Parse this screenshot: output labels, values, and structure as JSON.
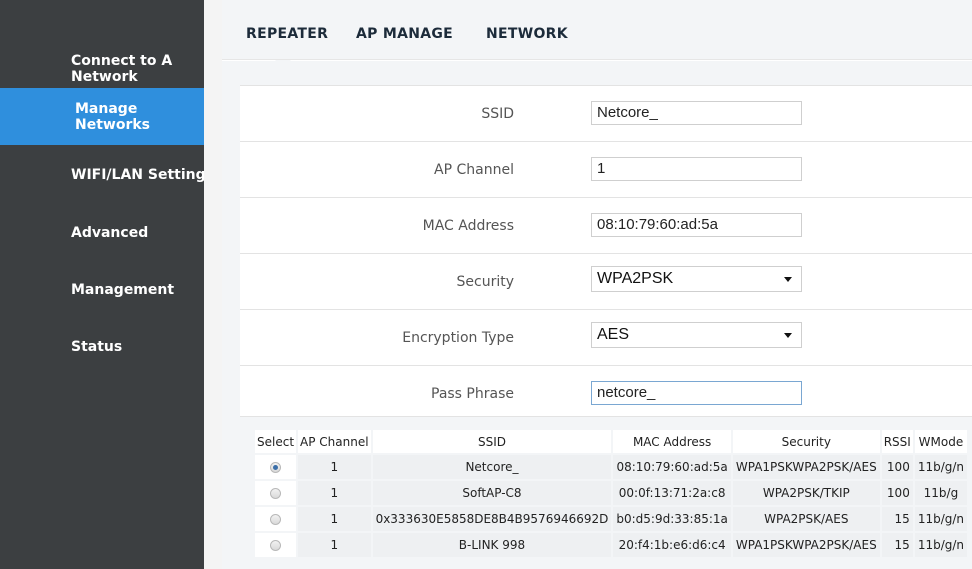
{
  "sidebar": {
    "items": [
      {
        "label": "Connect to A Network",
        "active": false
      },
      {
        "label": "Manage Networks",
        "active": true
      },
      {
        "label": "WIFI/LAN Settings",
        "active": false
      },
      {
        "label": "Advanced",
        "active": false
      },
      {
        "label": "Management",
        "active": false
      },
      {
        "label": "Status",
        "active": false
      }
    ]
  },
  "tabs": [
    {
      "label": "REPEATER",
      "active": true
    },
    {
      "label": "AP MANAGE",
      "active": false
    },
    {
      "label": "NETWORK",
      "active": false
    }
  ],
  "form": {
    "ssid": {
      "label": "SSID",
      "value": "Netcore_"
    },
    "ap_channel": {
      "label": "AP Channel",
      "value": "1"
    },
    "mac_address": {
      "label": "MAC Address",
      "value": "08:10:79:60:ad:5a"
    },
    "security": {
      "label": "Security",
      "value": "WPA2PSK"
    },
    "encryption_type": {
      "label": "Encryption Type",
      "value": "AES"
    },
    "pass_phrase": {
      "label": "Pass Phrase",
      "value": "netcore_"
    }
  },
  "table": {
    "headers": [
      "Select",
      "AP Channel",
      "SSID",
      "MAC Address",
      "Security",
      "RSSI",
      "WMode"
    ],
    "rows": [
      {
        "selected": true,
        "channel": "1",
        "ssid": "Netcore_",
        "mac": "08:10:79:60:ad:5a",
        "security": "WPA1PSKWPA2PSK/AES",
        "rssi": "100",
        "wmode": "11b/g/n"
      },
      {
        "selected": false,
        "channel": "1",
        "ssid": "SoftAP-C8",
        "mac": "00:0f:13:71:2a:c8",
        "security": "WPA2PSK/TKIP",
        "rssi": "100",
        "wmode": "11b/g"
      },
      {
        "selected": false,
        "channel": "1",
        "ssid": "0x333630E5858DE8B4B9576946692D",
        "mac": "b0:d5:9d:33:85:1a",
        "security": "WPA2PSK/AES",
        "rssi": "15",
        "wmode": "11b/g/n"
      },
      {
        "selected": false,
        "channel": "1",
        "ssid": "B-LINK 998",
        "mac": "20:f4:1b:e6:d6:c4",
        "security": "WPA1PSKWPA2PSK/AES",
        "rssi": "15",
        "wmode": "11b/g/n"
      }
    ]
  },
  "colors": {
    "sidebar_bg": "#3c3f41",
    "active_item": "#2f8fdd",
    "content_bg": "#f3f5f7"
  }
}
